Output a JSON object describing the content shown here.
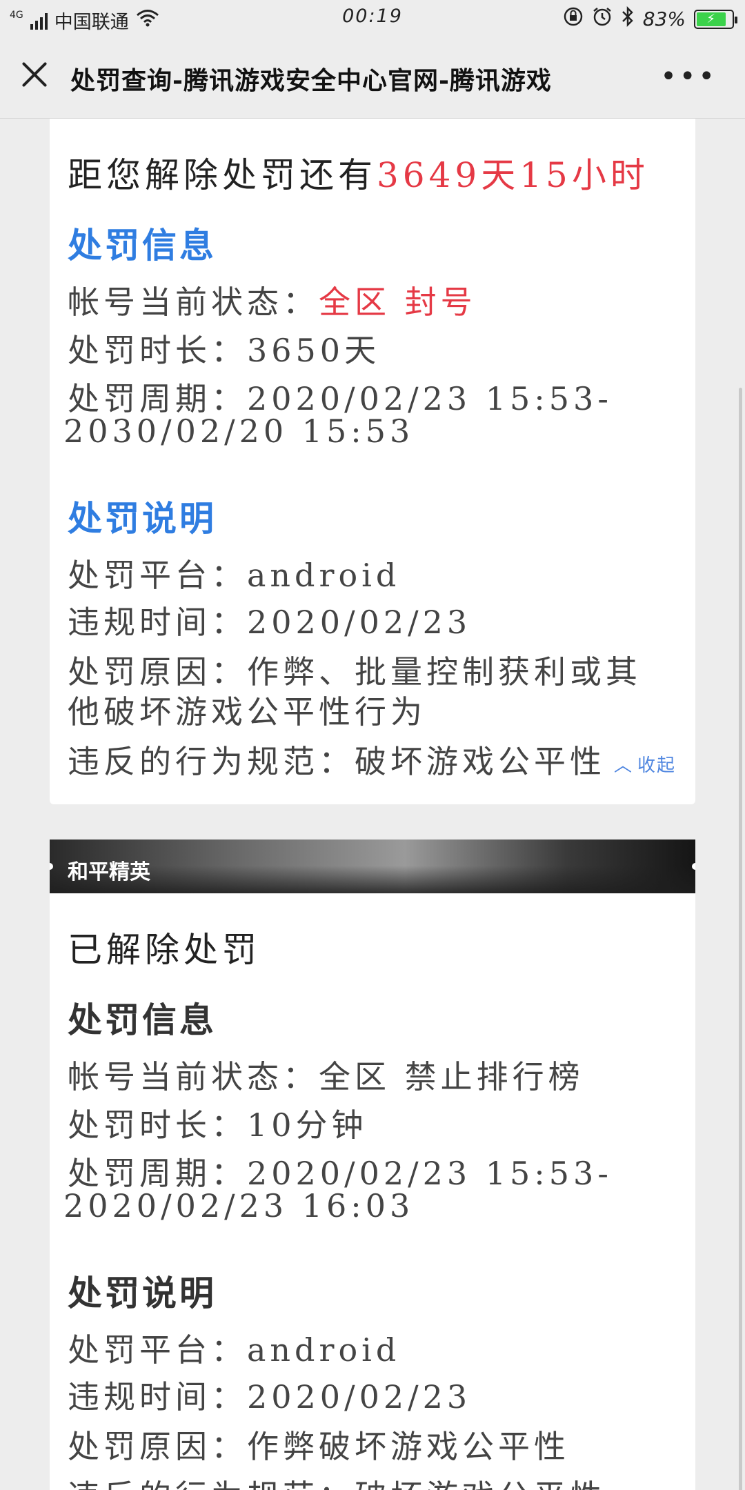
{
  "status_bar": {
    "network": "4G",
    "carrier": "中国联通",
    "time": "00:19",
    "battery": "83%"
  },
  "title_bar": {
    "title": "处罚查询-腾讯游戏安全中心官网-腾讯游戏",
    "more": "•••"
  },
  "card1": {
    "countdown_prefix": "距您解除处罚还有",
    "countdown_value": "3649天15小时",
    "info_heading": "处罚信息",
    "status_label": "帐号当前状态：",
    "status_value": "全区 封号",
    "duration": "处罚时长：3650天",
    "period_line1": "处罚周期：2020/02/23 15:53-",
    "period_line2": "2030/02/20 15:53",
    "desc_heading": "处罚说明",
    "platform": "处罚平台：android",
    "violation_time": "违规时间：2020/02/23",
    "reason_line1": "处罚原因：作弊、批量控制获利或其",
    "reason_line2": "他破坏游戏公平性行为",
    "norm": "违反的行为规范：破坏游戏公平性",
    "collapse": "收起",
    "colors": {
      "highlight": "#e53945",
      "heading": "#2f7de1"
    }
  },
  "card2": {
    "game_name": "和平精英",
    "state": "已解除处罚",
    "info_heading": "处罚信息",
    "status": "帐号当前状态：全区 禁止排行榜",
    "duration": "处罚时长：10分钟",
    "period_line1": "处罚周期：2020/02/23 15:53-",
    "period_line2": "2020/02/23 16:03",
    "desc_heading": "处罚说明",
    "platform": "处罚平台：android",
    "violation_time": "违规时间：2020/02/23",
    "reason": "处罚原因：作弊破坏游戏公平性",
    "norm": "违反的行为规范：破坏游戏公平性"
  }
}
